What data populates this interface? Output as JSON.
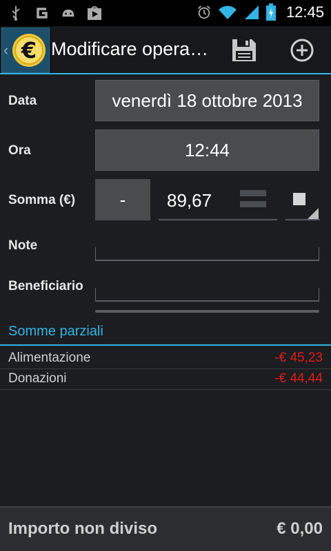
{
  "status_bar": {
    "time": "12:45",
    "icons": [
      "usb-icon",
      "g-icon",
      "android-icon",
      "play-store-icon",
      "alarm-icon",
      "wifi-icon",
      "signal-icon",
      "battery-charging-icon"
    ]
  },
  "action_bar": {
    "title": "Modificare opera…",
    "actions": [
      "save-icon",
      "add-icon"
    ]
  },
  "form": {
    "date_label": "Data",
    "date_value": "venerdì 18 ottobre 2013",
    "time_label": "Ora",
    "time_value": "12:44",
    "amount_label": "Somma (€)",
    "sign_button": "-",
    "amount_value": "89,67",
    "note_label": "Note",
    "note_value": "",
    "payee_label": "Beneficiario",
    "payee_value": ""
  },
  "split": {
    "header": "Somme parziali",
    "items": [
      {
        "name": "Alimentazione",
        "amount": "-€ 45,23"
      },
      {
        "name": "Donazioni",
        "amount": "-€ 44,44"
      }
    ]
  },
  "footer": {
    "label": "Importo non diviso",
    "value": "€ 0,00"
  },
  "colors": {
    "accent": "#33b5e5",
    "negative": "#e41b17",
    "button_bg": "#4a4b4d",
    "background": "#1b1d21"
  }
}
